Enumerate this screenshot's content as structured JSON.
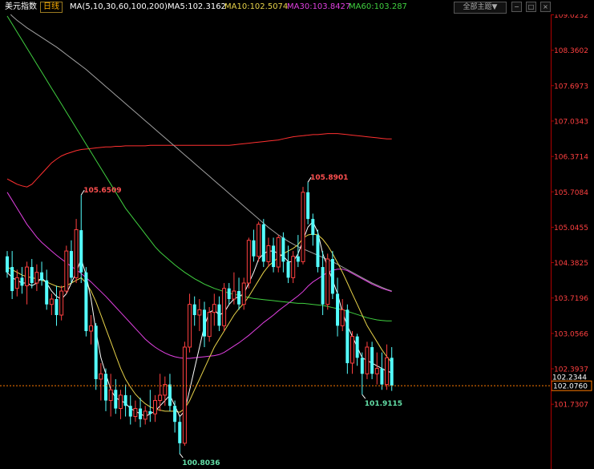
{
  "header": {
    "instrument": "美元指数",
    "period": "日线",
    "ma_params": "MA(5,10,30,60,100,200)",
    "ma5": "MA5:102.3162",
    "ma10": "MA10:102.5074",
    "ma30": "MA30:103.8427",
    "ma60": "MA60:103.287",
    "theme_select": "全部主题▼",
    "buttons": [
      "−",
      "□",
      "×"
    ]
  },
  "colors": {
    "up": "#ff4040",
    "down": "#54ffff",
    "ma5": "#ffffff",
    "ma10": "#e8d34a",
    "ma30": "#e040e0",
    "ma60": "#40d040",
    "ma100": "#a0a0a0",
    "ma200": "#ff3030",
    "last_price_line": "#ff7a00"
  },
  "chart_data": {
    "type": "candlestick",
    "ylim": [
      100.55,
      109.3
    ],
    "ytick_labels": [
      "109.0232",
      "108.3602",
      "107.6973",
      "107.0343",
      "106.3714",
      "105.7084",
      "105.0455",
      "104.3825",
      "103.7196",
      "103.0566",
      "102.3937",
      "101.7307"
    ],
    "last_price": 102.076,
    "last_price_label": "102.0760",
    "marker_price_label": "102.2344",
    "marker_price": 102.2344,
    "annotations": [
      {
        "text": "105.6509",
        "value": 105.6509,
        "index": 15
      },
      {
        "text": "100.8036",
        "value": 100.8036,
        "index": 35
      },
      {
        "text": "105.8901",
        "value": 105.8901,
        "index": 61
      },
      {
        "text": "101.9115",
        "value": 101.9115,
        "index": 72
      }
    ],
    "candles": [
      [
        104.5,
        104.6,
        104.1,
        104.2
      ],
      [
        104.3,
        104.6,
        103.7,
        103.85
      ],
      [
        103.9,
        104.25,
        103.75,
        104.1
      ],
      [
        104.1,
        104.3,
        103.8,
        103.95
      ],
      [
        103.95,
        104.4,
        103.6,
        104.3
      ],
      [
        104.3,
        104.45,
        103.9,
        104.0
      ],
      [
        104.0,
        104.35,
        103.85,
        104.2
      ],
      [
        104.2,
        104.4,
        103.95,
        104.05
      ],
      [
        104.05,
        104.25,
        103.5,
        103.6
      ],
      [
        103.6,
        103.8,
        103.4,
        103.7
      ],
      [
        103.7,
        103.95,
        103.2,
        103.4
      ],
      [
        103.4,
        103.95,
        103.3,
        103.85
      ],
      [
        103.85,
        104.7,
        103.8,
        104.6
      ],
      [
        104.6,
        104.8,
        104.0,
        104.1
      ],
      [
        104.1,
        105.2,
        104.0,
        105.0
      ],
      [
        104.99,
        105.65,
        104.0,
        104.2
      ],
      [
        104.2,
        104.3,
        103.0,
        103.1
      ],
      [
        103.1,
        103.4,
        102.85,
        103.2
      ],
      [
        103.2,
        103.25,
        102.0,
        102.2
      ],
      [
        102.2,
        102.5,
        101.8,
        102.3
      ],
      [
        102.3,
        102.4,
        101.6,
        101.8
      ],
      [
        101.8,
        102.3,
        101.5,
        102.0
      ],
      [
        102.0,
        102.2,
        101.55,
        101.65
      ],
      [
        101.65,
        102.0,
        101.45,
        101.9
      ],
      [
        101.9,
        102.1,
        101.5,
        101.7
      ],
      [
        101.7,
        101.9,
        101.35,
        101.5
      ],
      [
        101.5,
        101.8,
        101.4,
        101.65
      ],
      [
        101.65,
        101.85,
        101.3,
        101.45
      ],
      [
        101.45,
        101.7,
        101.35,
        101.6
      ],
      [
        101.6,
        102.0,
        101.4,
        101.55
      ],
      [
        101.55,
        101.9,
        101.4,
        101.8
      ],
      [
        101.8,
        102.3,
        101.6,
        101.9
      ],
      [
        101.9,
        102.25,
        101.7,
        102.1
      ],
      [
        102.1,
        102.3,
        101.6,
        101.7
      ],
      [
        101.7,
        101.8,
        101.2,
        101.4
      ],
      [
        101.4,
        101.5,
        100.8,
        101.0
      ],
      [
        101.0,
        102.9,
        100.95,
        102.8
      ],
      [
        102.8,
        103.8,
        102.7,
        103.6
      ],
      [
        103.6,
        103.75,
        103.2,
        103.4
      ],
      [
        103.4,
        103.7,
        103.1,
        103.5
      ],
      [
        103.5,
        103.65,
        102.8,
        103.0
      ],
      [
        103.0,
        103.55,
        102.9,
        103.45
      ],
      [
        103.45,
        103.8,
        103.2,
        103.6
      ],
      [
        103.6,
        103.75,
        103.1,
        103.2
      ],
      [
        103.2,
        104.0,
        103.1,
        103.9
      ],
      [
        103.9,
        104.0,
        103.6,
        103.7
      ],
      [
        103.7,
        104.2,
        103.6,
        103.85
      ],
      [
        103.85,
        104.1,
        103.5,
        103.6
      ],
      [
        103.6,
        104.1,
        103.5,
        104.0
      ],
      [
        104.0,
        104.85,
        103.9,
        104.8
      ],
      [
        104.8,
        105.0,
        104.4,
        104.5
      ],
      [
        104.5,
        105.15,
        104.4,
        105.1
      ],
      [
        105.1,
        105.2,
        104.3,
        104.4
      ],
      [
        104.4,
        104.85,
        104.3,
        104.7
      ],
      [
        104.7,
        104.85,
        104.2,
        104.3
      ],
      [
        104.3,
        104.9,
        104.2,
        104.85
      ],
      [
        104.85,
        104.95,
        104.2,
        104.4
      ],
      [
        104.4,
        104.7,
        104.0,
        104.1
      ],
      [
        104.1,
        104.6,
        104.0,
        104.5
      ],
      [
        104.5,
        104.9,
        104.3,
        104.4
      ],
      [
        104.4,
        105.8,
        104.35,
        105.7
      ],
      [
        105.7,
        105.89,
        105.1,
        105.2
      ],
      [
        105.2,
        105.3,
        104.7,
        104.9
      ],
      [
        104.9,
        105.0,
        104.2,
        104.3
      ],
      [
        104.3,
        104.6,
        103.4,
        103.6
      ],
      [
        103.6,
        104.55,
        103.5,
        104.45
      ],
      [
        104.45,
        104.6,
        103.7,
        103.8
      ],
      [
        103.8,
        104.1,
        103.0,
        103.2
      ],
      [
        103.2,
        103.7,
        103.1,
        103.5
      ],
      [
        103.5,
        103.6,
        102.3,
        102.5
      ],
      [
        102.5,
        103.1,
        102.3,
        103.0
      ],
      [
        103.0,
        103.05,
        102.45,
        102.6
      ],
      [
        102.6,
        102.7,
        101.91,
        102.3
      ],
      [
        102.3,
        102.9,
        102.2,
        102.8
      ],
      [
        102.8,
        102.9,
        102.2,
        102.3
      ],
      [
        102.3,
        102.7,
        102.1,
        102.4
      ],
      [
        102.4,
        102.7,
        102.0,
        102.1
      ],
      [
        102.1,
        102.85,
        102.0,
        102.6
      ],
      [
        102.6,
        102.8,
        101.98,
        102.08
      ]
    ],
    "ma_lines": [
      {
        "name": "MA200",
        "values": [
          105.95,
          105.9,
          105.85,
          105.82,
          105.8,
          105.85,
          105.95,
          106.05,
          106.15,
          106.25,
          106.32,
          106.38,
          106.42,
          106.45,
          106.48,
          106.5,
          106.51,
          106.52,
          106.53,
          106.54,
          106.55,
          106.55,
          106.56,
          106.56,
          106.57,
          106.57,
          106.57,
          106.57,
          106.57,
          106.58,
          106.58,
          106.58,
          106.58,
          106.58,
          106.58,
          106.58,
          106.58,
          106.58,
          106.58,
          106.58,
          106.58,
          106.58,
          106.58,
          106.58,
          106.58,
          106.58,
          106.59,
          106.6,
          106.61,
          106.62,
          106.63,
          106.64,
          106.65,
          106.66,
          106.67,
          106.68,
          106.7,
          106.72,
          106.74,
          106.75,
          106.76,
          106.77,
          106.78,
          106.78,
          106.79,
          106.8,
          106.8,
          106.8,
          106.79,
          106.78,
          106.77,
          106.76,
          106.75,
          106.74,
          106.73,
          106.72,
          106.71,
          106.7,
          106.7
        ]
      },
      {
        "name": "MA100",
        "values": [
          109.1,
          109.0,
          108.92,
          108.85,
          108.78,
          108.72,
          108.66,
          108.6,
          108.54,
          108.48,
          108.42,
          108.35,
          108.28,
          108.21,
          108.14,
          108.07,
          108.0,
          107.92,
          107.84,
          107.76,
          107.68,
          107.6,
          107.52,
          107.44,
          107.36,
          107.28,
          107.2,
          107.12,
          107.04,
          106.96,
          106.88,
          106.8,
          106.72,
          106.64,
          106.56,
          106.48,
          106.4,
          106.32,
          106.24,
          106.16,
          106.08,
          106.0,
          105.92,
          105.84,
          105.76,
          105.68,
          105.6,
          105.52,
          105.44,
          105.36,
          105.28,
          105.2,
          105.12,
          105.04,
          104.97,
          104.9,
          104.84,
          104.78,
          104.73,
          104.68,
          104.64,
          104.6,
          104.56,
          104.52,
          104.48,
          104.44,
          104.4,
          104.35,
          104.3,
          104.25,
          104.2,
          104.15,
          104.1,
          104.05,
          104.0,
          103.96,
          103.92,
          103.88,
          103.85
        ]
      },
      {
        "name": "MA60",
        "values": [
          109.0,
          108.85,
          108.7,
          108.55,
          108.4,
          108.25,
          108.1,
          107.95,
          107.8,
          107.65,
          107.5,
          107.35,
          107.2,
          107.05,
          106.9,
          106.75,
          106.6,
          106.45,
          106.3,
          106.15,
          106.0,
          105.85,
          105.7,
          105.55,
          105.4,
          105.28,
          105.16,
          105.04,
          104.92,
          104.8,
          104.68,
          104.58,
          104.5,
          104.42,
          104.34,
          104.27,
          104.2,
          104.14,
          104.08,
          104.03,
          103.98,
          103.94,
          103.9,
          103.87,
          103.84,
          103.81,
          103.79,
          103.77,
          103.75,
          103.73,
          103.71,
          103.7,
          103.69,
          103.68,
          103.67,
          103.66,
          103.65,
          103.64,
          103.63,
          103.62,
          103.62,
          103.61,
          103.6,
          103.59,
          103.58,
          103.56,
          103.54,
          103.52,
          103.5,
          103.47,
          103.44,
          103.41,
          103.38,
          103.35,
          103.33,
          103.31,
          103.3,
          103.29,
          103.29
        ]
      },
      {
        "name": "MA30",
        "values": [
          105.7,
          105.55,
          105.4,
          105.25,
          105.1,
          104.98,
          104.86,
          104.76,
          104.68,
          104.6,
          104.52,
          104.45,
          104.38,
          104.31,
          104.25,
          104.18,
          104.1,
          104.02,
          103.93,
          103.84,
          103.75,
          103.65,
          103.55,
          103.45,
          103.35,
          103.25,
          103.15,
          103.05,
          102.95,
          102.87,
          102.8,
          102.74,
          102.69,
          102.65,
          102.62,
          102.6,
          102.59,
          102.59,
          102.6,
          102.61,
          102.62,
          102.63,
          102.64,
          102.66,
          102.7,
          102.76,
          102.82,
          102.88,
          102.95,
          103.02,
          103.1,
          103.18,
          103.26,
          103.33,
          103.4,
          103.48,
          103.55,
          103.62,
          103.69,
          103.76,
          103.84,
          103.94,
          104.02,
          104.08,
          104.14,
          104.2,
          104.24,
          104.26,
          104.26,
          104.23,
          104.18,
          104.13,
          104.08,
          104.03,
          103.98,
          103.94,
          103.9,
          103.87,
          103.84
        ]
      },
      {
        "name": "MA10",
        "values": [
          104.3,
          104.25,
          104.2,
          104.15,
          104.12,
          104.1,
          104.08,
          104.05,
          104.02,
          103.98,
          103.94,
          103.92,
          103.95,
          104.0,
          104.05,
          104.1,
          104.0,
          103.85,
          103.65,
          103.4,
          103.15,
          102.9,
          102.65,
          102.4,
          102.2,
          102.05,
          101.92,
          101.82,
          101.74,
          101.68,
          101.64,
          101.62,
          101.6,
          101.6,
          101.6,
          101.58,
          101.65,
          101.8,
          102.0,
          102.2,
          102.4,
          102.6,
          102.8,
          102.95,
          103.1,
          103.25,
          103.4,
          103.52,
          103.62,
          103.75,
          103.9,
          104.05,
          104.2,
          104.32,
          104.4,
          104.48,
          104.55,
          104.6,
          104.65,
          104.72,
          104.84,
          104.9,
          104.92,
          104.9,
          104.82,
          104.7,
          104.55,
          104.38,
          104.2,
          104.0,
          103.8,
          103.6,
          103.4,
          103.2,
          103.05,
          102.9,
          102.75,
          102.62,
          102.51
        ]
      },
      {
        "name": "MA5",
        "values": [
          104.2,
          104.1,
          104.05,
          104.0,
          104.0,
          103.95,
          104.0,
          104.1,
          104.0,
          103.85,
          103.75,
          103.7,
          103.8,
          104.0,
          104.2,
          104.45,
          104.15,
          103.7,
          103.1,
          102.6,
          102.3,
          102.0,
          101.85,
          101.8,
          101.75,
          101.65,
          101.6,
          101.55,
          101.5,
          101.55,
          101.6,
          101.7,
          101.8,
          101.9,
          101.7,
          101.5,
          101.6,
          102.0,
          102.4,
          102.8,
          103.2,
          103.45,
          103.5,
          103.4,
          103.45,
          103.6,
          103.7,
          103.75,
          103.8,
          104.0,
          104.2,
          104.45,
          104.55,
          104.6,
          104.6,
          104.55,
          104.5,
          104.4,
          104.4,
          104.55,
          104.8,
          105.05,
          105.15,
          104.95,
          104.55,
          104.3,
          104.05,
          103.8,
          103.45,
          103.2,
          103.0,
          102.8,
          102.6,
          102.55,
          102.5,
          102.45,
          102.4,
          102.35,
          102.32
        ]
      }
    ]
  }
}
